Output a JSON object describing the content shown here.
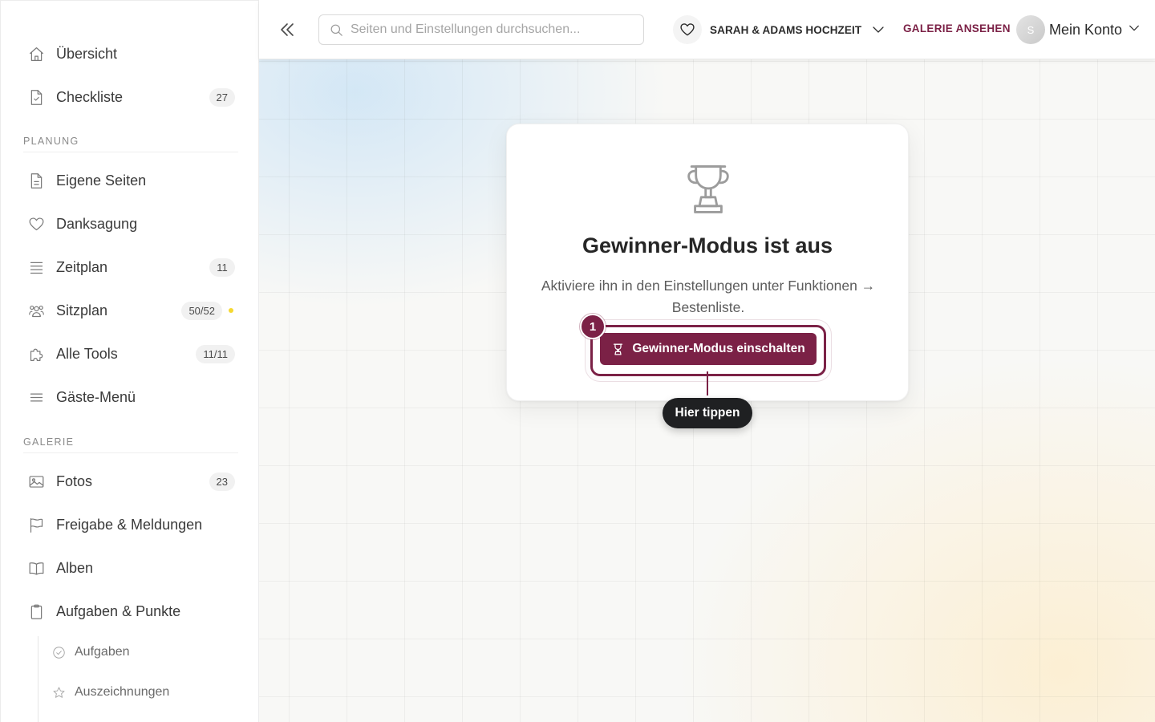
{
  "sidebar": {
    "top_items": [
      {
        "label": "Übersicht",
        "icon": "home-icon"
      },
      {
        "label": "Checkliste",
        "icon": "checklist-icon",
        "badge": "27"
      }
    ],
    "sections": [
      {
        "title": "PLANUNG",
        "items": [
          {
            "label": "Eigene Seiten",
            "icon": "document-icon"
          },
          {
            "label": "Danksagung",
            "icon": "heart-icon"
          },
          {
            "label": "Zeitplan",
            "icon": "list-icon",
            "badge": "11"
          },
          {
            "label": "Sitzplan",
            "icon": "people-icon",
            "badge": "50/52",
            "dot_color": "#f5d830"
          },
          {
            "label": "Alle Tools",
            "icon": "puzzle-icon",
            "badge": "11/11"
          },
          {
            "label": "Gäste-Menü",
            "icon": "menu-icon"
          }
        ]
      },
      {
        "title": "GALERIE",
        "items": [
          {
            "label": "Fotos",
            "icon": "image-icon",
            "badge": "23"
          },
          {
            "label": "Freigabe & Meldungen",
            "icon": "flag-icon"
          },
          {
            "label": "Alben",
            "icon": "book-icon"
          },
          {
            "label": "Aufgaben & Punkte",
            "icon": "clipboard-icon"
          }
        ]
      }
    ],
    "sub_items": [
      {
        "label": "Aufgaben",
        "icon": "check-circle-icon"
      },
      {
        "label": "Auszeichnungen",
        "icon": "star-icon"
      }
    ]
  },
  "topbar": {
    "search_placeholder": "Seiten und Einstellungen durchsuchen...",
    "event_name": "SARAH & ADAMS HOCHZEIT",
    "gallery_link": "GALERIE ANSEHEN",
    "avatar_initial": "S",
    "account_label": "Mein Konto"
  },
  "main": {
    "card": {
      "icon": "trophy-icon",
      "title": "Gewinner-Modus ist aus",
      "text": "Aktiviere ihn in den Einstellungen unter Funktionen → Bestenliste.",
      "button_label": "Gewinner-Modus einschalten"
    },
    "guide": {
      "step_number": "1",
      "tooltip": "Hier tippen"
    }
  },
  "colors": {
    "accent": "#7b2146",
    "tooltip_bg": "#1f2022",
    "status_dot": "#f5d830"
  }
}
